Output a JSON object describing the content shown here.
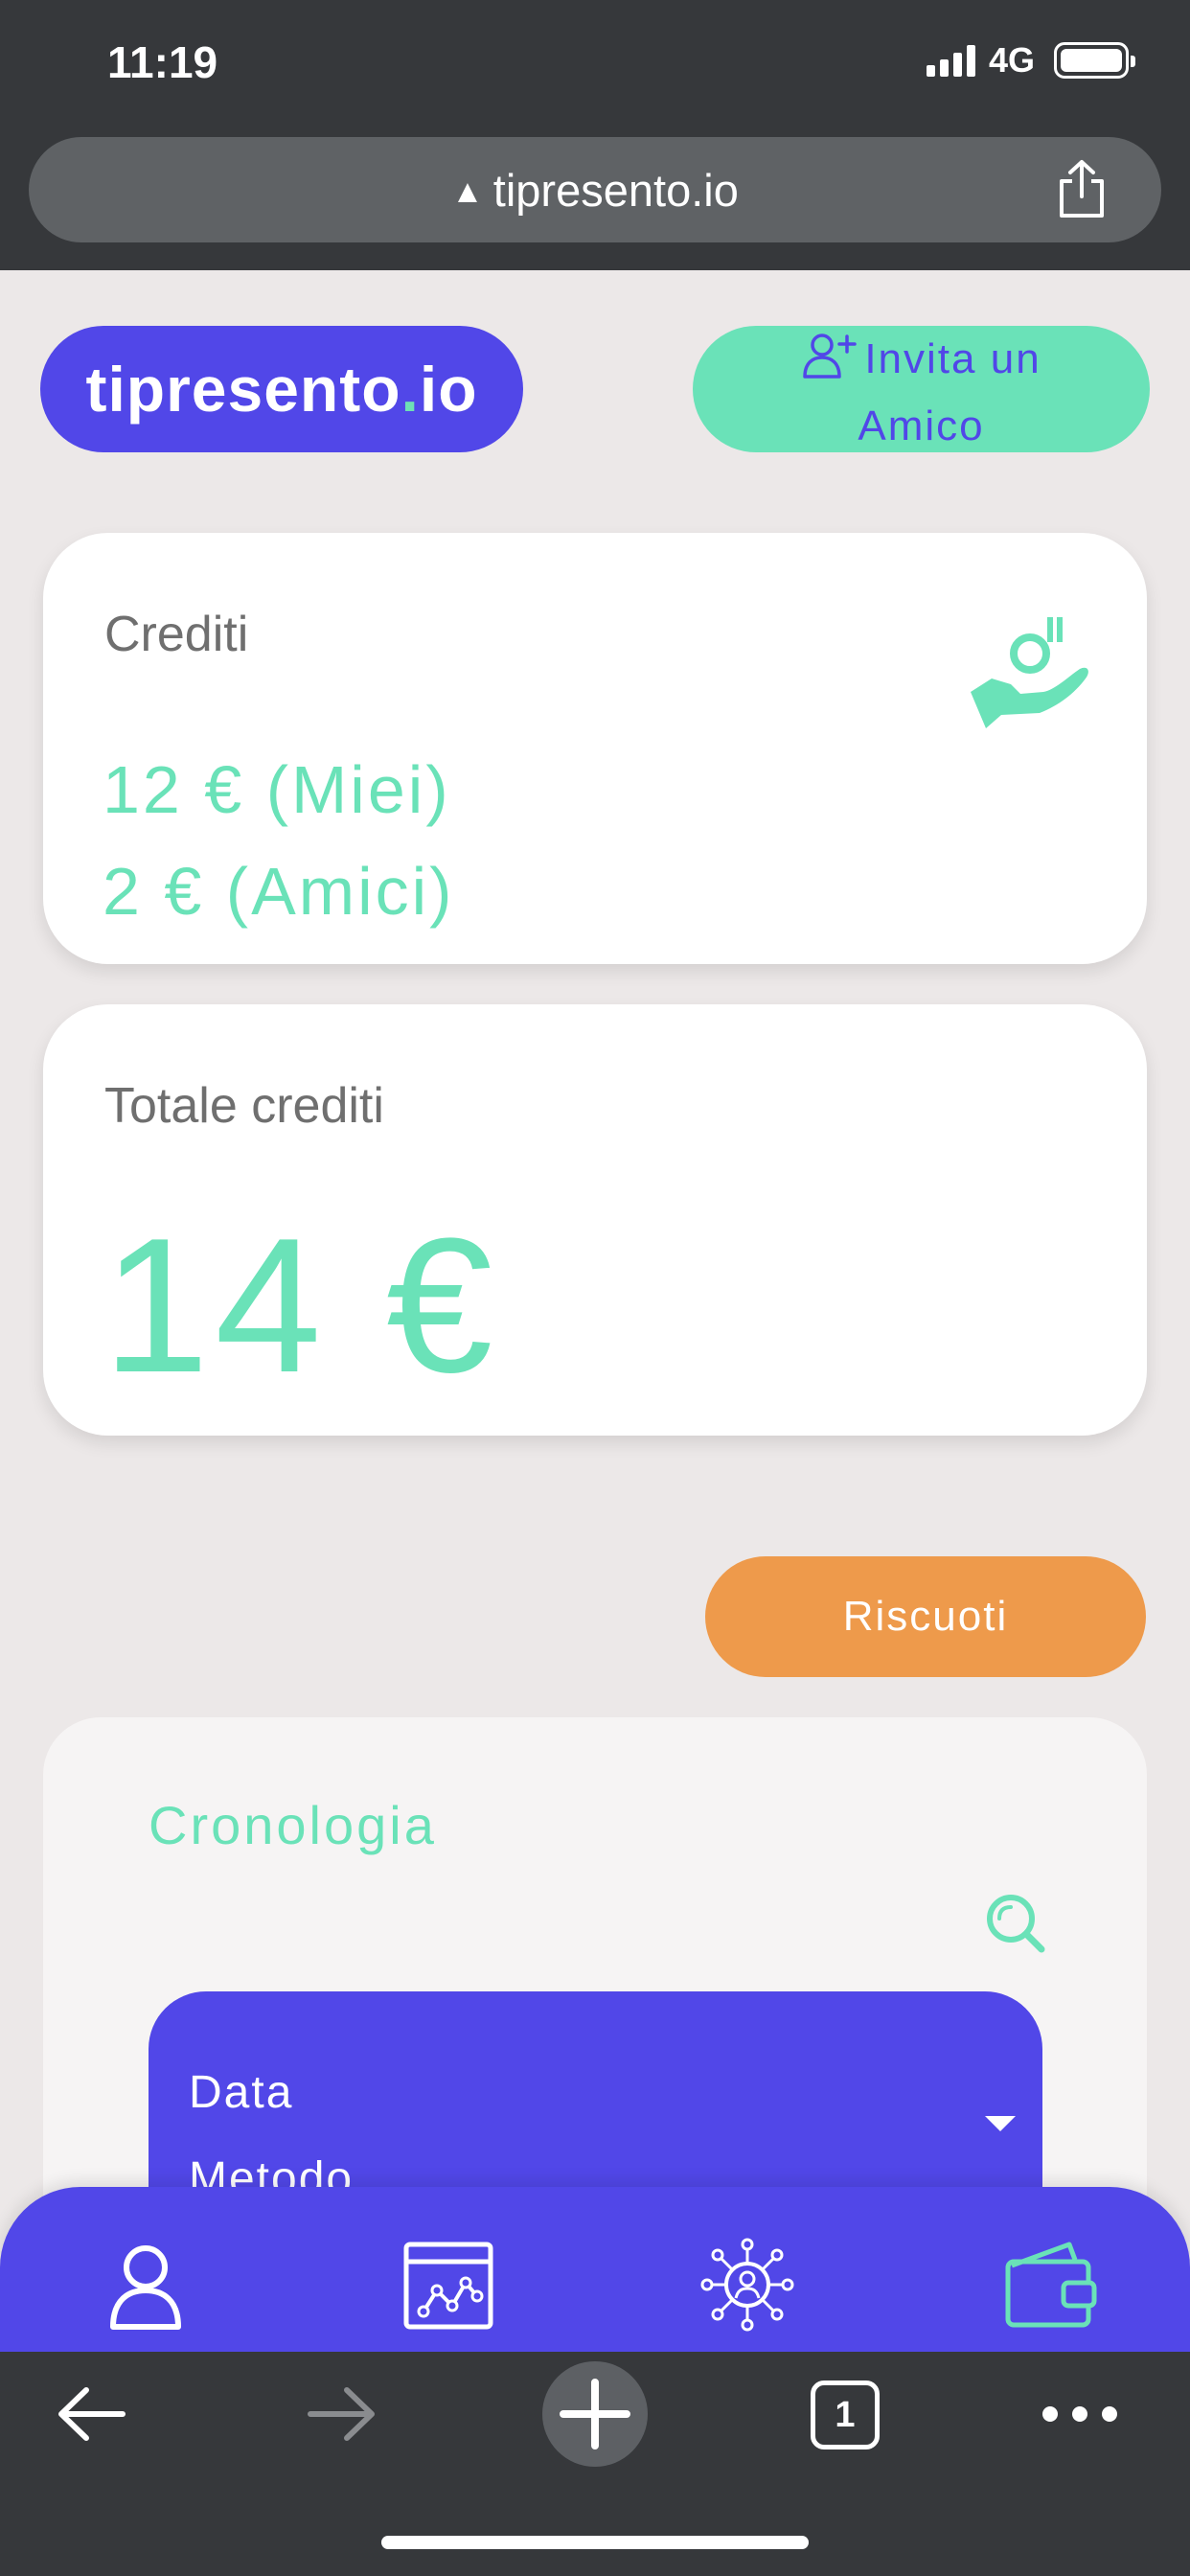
{
  "status_bar": {
    "time": "11:19",
    "network": "4G"
  },
  "browser": {
    "url": "tipresento.io"
  },
  "header": {
    "logo_main": "tipresento",
    "logo_dot": ".",
    "logo_suffix": "io",
    "invite_line1": "Invita un",
    "invite_line2": "Amico"
  },
  "credits_card": {
    "title": "Crediti",
    "mine": "12 € (Miei)",
    "friends": "2 € (Amici)"
  },
  "total_card": {
    "title": "Totale crediti",
    "value": "14 €"
  },
  "collect_button": "Riscuoti",
  "history": {
    "title": "Cronologia",
    "filter_selected": "Data",
    "filter_next_partial": "Metodo"
  },
  "browser_tabs_count": "1",
  "colors": {
    "primary": "#5147e8",
    "accent_green": "#6ae2b8",
    "orange": "#ee9a4b",
    "background": "#ece8e8",
    "chrome": "#36383b"
  },
  "icons": {
    "tabbar": [
      "user-icon",
      "chart-icon",
      "network-icon",
      "wallet-icon"
    ],
    "browser": [
      "back-arrow-icon",
      "forward-arrow-icon",
      "plus-icon",
      "tabs-icon",
      "more-icon"
    ]
  }
}
